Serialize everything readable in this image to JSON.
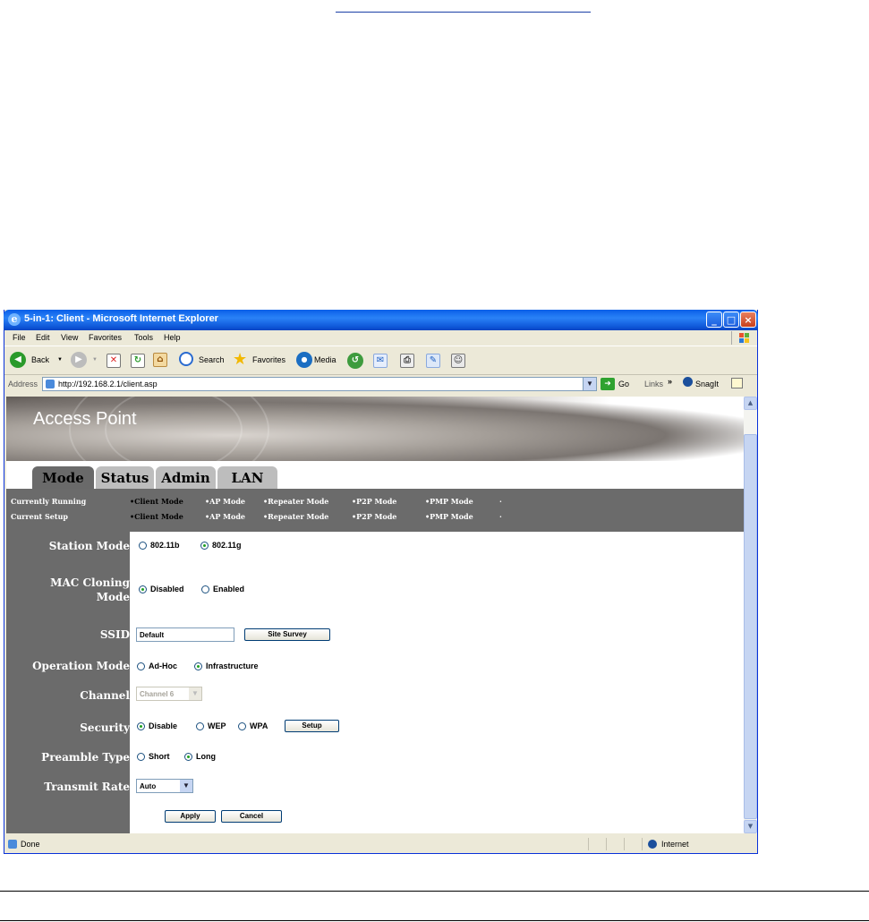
{
  "window": {
    "title": "5-in-1: Client - Microsoft Internet Explorer",
    "buttons": {
      "minimize": "_",
      "maximize": "□",
      "close": "×"
    }
  },
  "menu": [
    "File",
    "Edit",
    "View",
    "Favorites",
    "Tools",
    "Help"
  ],
  "toolbar": {
    "back": "Back",
    "search": "Search",
    "favorites": "Favorites",
    "media": "Media"
  },
  "address": {
    "label": "Address",
    "url": "http://192.168.2.1/client.asp",
    "go": "Go",
    "links": "Links",
    "links_chevron": "»",
    "snagit": "SnagIt"
  },
  "page": {
    "brand": "Access Point",
    "tabs": [
      "Mode",
      "Status",
      "Admin",
      "LAN"
    ],
    "active_tab": "Mode",
    "mode_bar": {
      "row1_label": "Currently Running",
      "row2_label": "Current Setup",
      "modes": [
        "•Client Mode",
        "•AP Mode",
        "•Repeater Mode",
        "•P2P Mode",
        "•PMP Mode"
      ],
      "selected_mode": "•Client Mode"
    },
    "form": {
      "station_mode": {
        "label": "Station Mode",
        "options": [
          "802.11b",
          "802.11g"
        ],
        "selected": "802.11g"
      },
      "mac_cloning": {
        "label_line1": "MAC Cloning",
        "label_line2": "Mode",
        "options": [
          "Disabled",
          "Enabled"
        ],
        "selected": "Disabled"
      },
      "ssid": {
        "label": "SSID",
        "value": "Default",
        "button": "Site Survey"
      },
      "operation_mode": {
        "label": "Operation Mode",
        "options": [
          "Ad-Hoc",
          "Infrastructure"
        ],
        "selected": "Infrastructure"
      },
      "channel": {
        "label": "Channel",
        "value": "Channel 6",
        "disabled": true
      },
      "security": {
        "label": "Security",
        "options": [
          "Disable",
          "WEP",
          "WPA"
        ],
        "selected": "Disable",
        "button": "Setup"
      },
      "preamble": {
        "label": "Preamble Type",
        "options": [
          "Short",
          "Long"
        ],
        "selected": "Long"
      },
      "transmit_rate": {
        "label": "Transmit Rate",
        "value": "Auto"
      },
      "apply": "Apply",
      "cancel": "Cancel"
    }
  },
  "status": {
    "left": "Done",
    "zone": "Internet"
  },
  "colors": {
    "title_blue": "#0a5fe8",
    "panel_gray": "#6b6b6b",
    "tab_gray": "#bdbdbd"
  }
}
